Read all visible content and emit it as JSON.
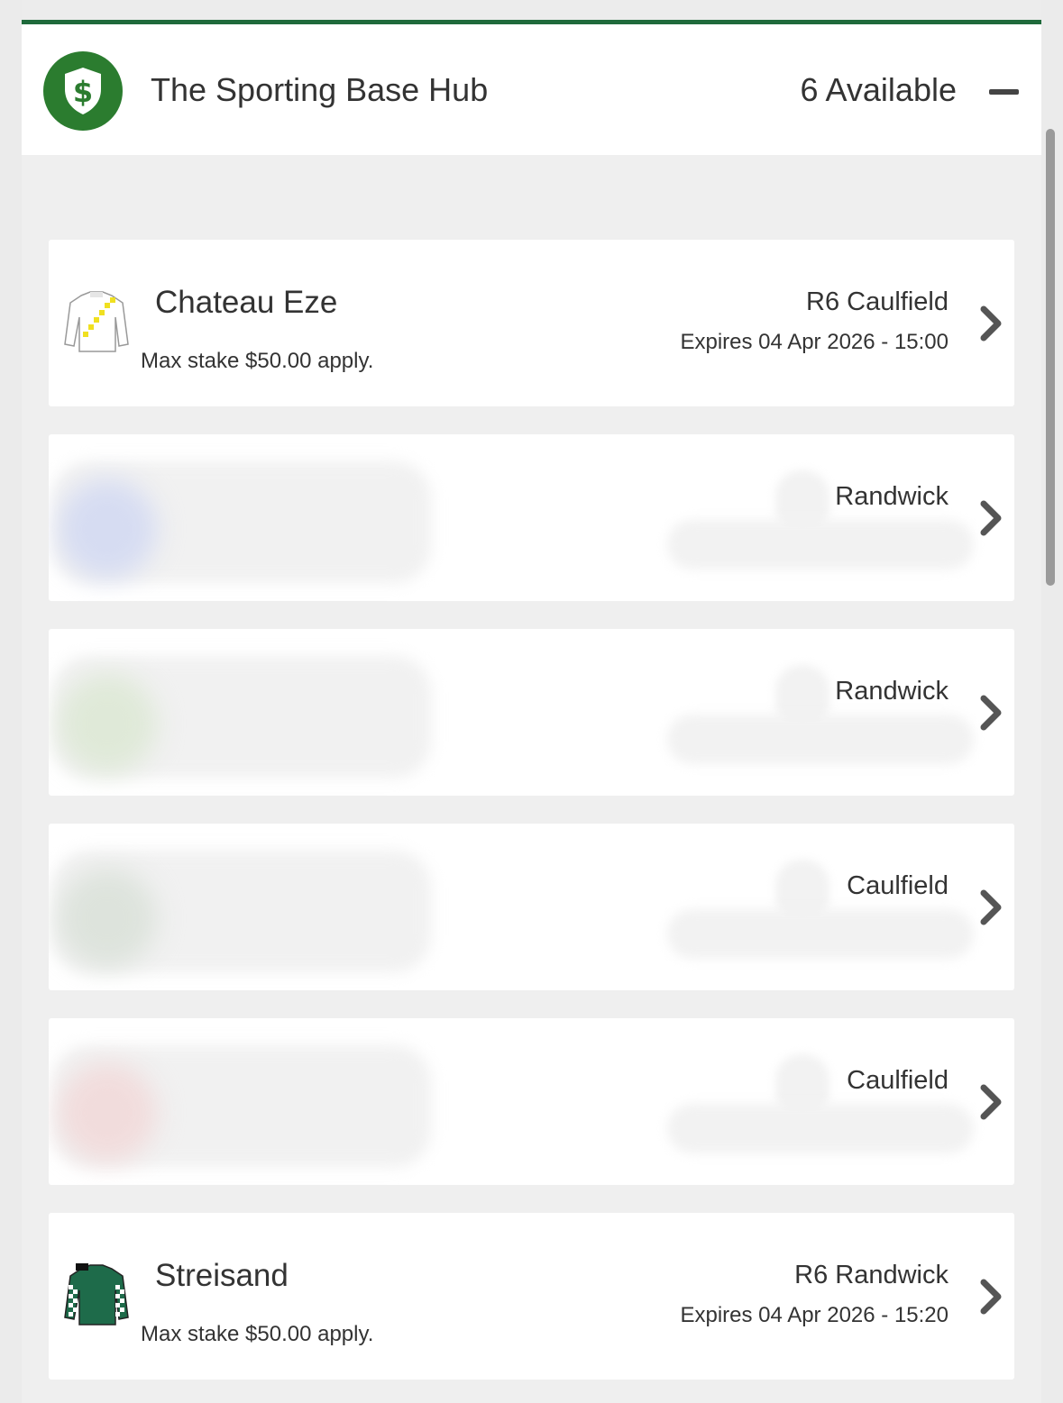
{
  "hub": {
    "title": "The Sporting Base Hub",
    "available": "6 Available",
    "icon": "shield-dollar-icon",
    "accent_color": "#1f6a3b",
    "logo_color": "#2b7c2f"
  },
  "offers": [
    {
      "runner": "Chateau Eze",
      "stake_note": "Max stake $50.00 apply.",
      "race": "R6 Caulfield",
      "expiry": "Expires 04 Apr 2026 - 15:00",
      "silk_icon": "white-yellow-silks-icon"
    },
    {
      "venue": "Randwick",
      "blur_tint": "#d6dcf2"
    },
    {
      "venue": "Randwick",
      "blur_tint": "#dfe9d8"
    },
    {
      "venue": "Caulfield",
      "blur_tint": "#dde3dc"
    },
    {
      "venue": "Caulfield",
      "blur_tint": "#f1dcdc"
    },
    {
      "runner": "Streisand",
      "stake_note": "Max stake $50.00 apply.",
      "race": "R6 Randwick",
      "expiry": "Expires 04 Apr 2026 - 15:20",
      "silk_icon": "green-checked-silks-icon"
    }
  ]
}
